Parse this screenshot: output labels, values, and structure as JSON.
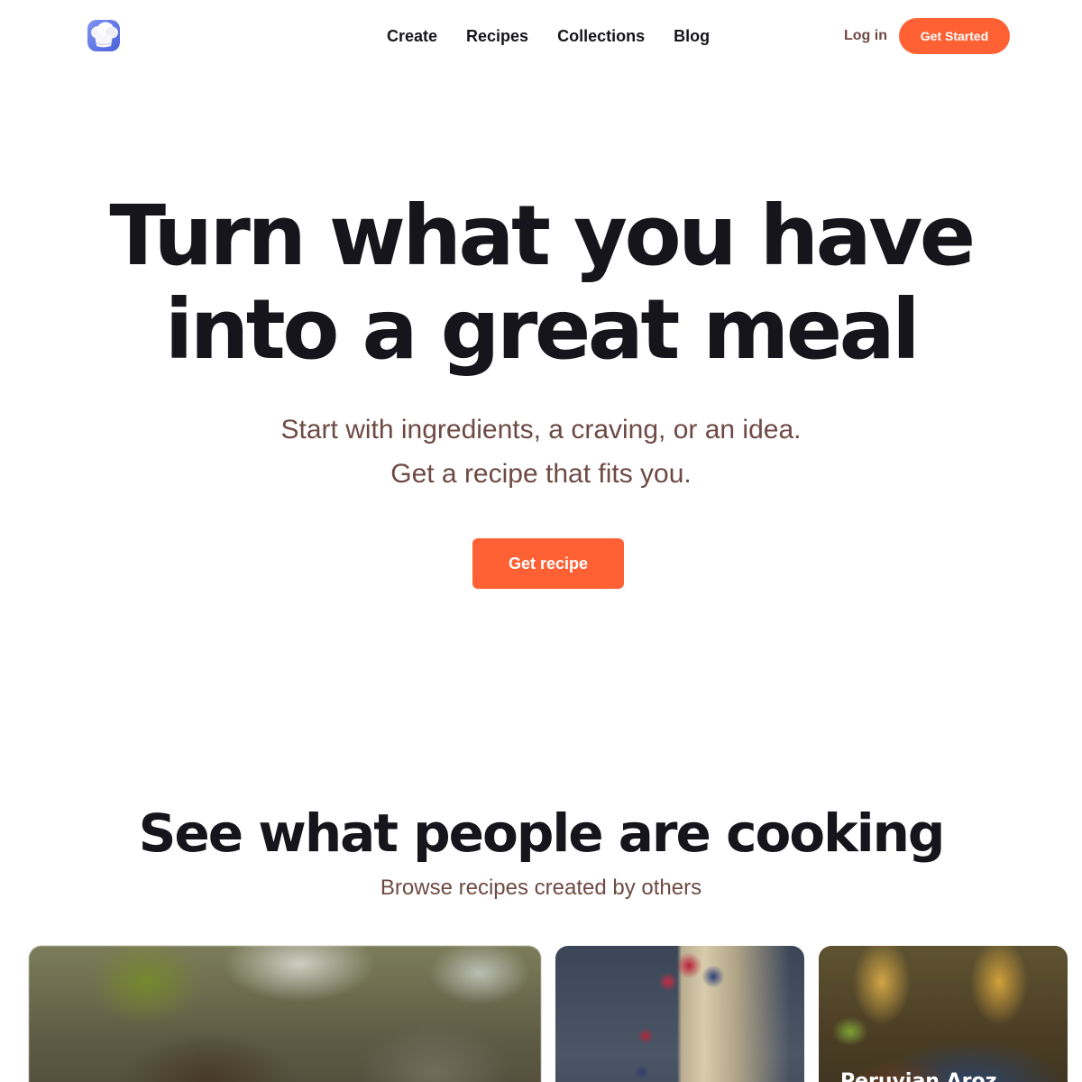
{
  "header": {
    "logo_icon": "chef-hat-icon",
    "nav": [
      "Create",
      "Recipes",
      "Collections",
      "Blog"
    ],
    "login_label": "Log in",
    "get_started_label": "Get Started"
  },
  "hero": {
    "title_lines": [
      "Turn what you have",
      "into a great meal"
    ],
    "subtitle_lines": [
      "Start with ingredients, a craving, or an idea.",
      "Get a recipe that fits you."
    ],
    "cta_label": "Get recipe"
  },
  "section": {
    "title": "See what people are cooking",
    "subtitle": "Browse recipes created by others"
  },
  "cards": [
    {
      "title": ""
    },
    {
      "title": ""
    },
    {
      "title": "Peruvian Aroz"
    }
  ],
  "colors": {
    "accent": "#ff6134",
    "heading": "#17151c",
    "muted_text": "#6e4a44",
    "background": "#ffffff"
  }
}
